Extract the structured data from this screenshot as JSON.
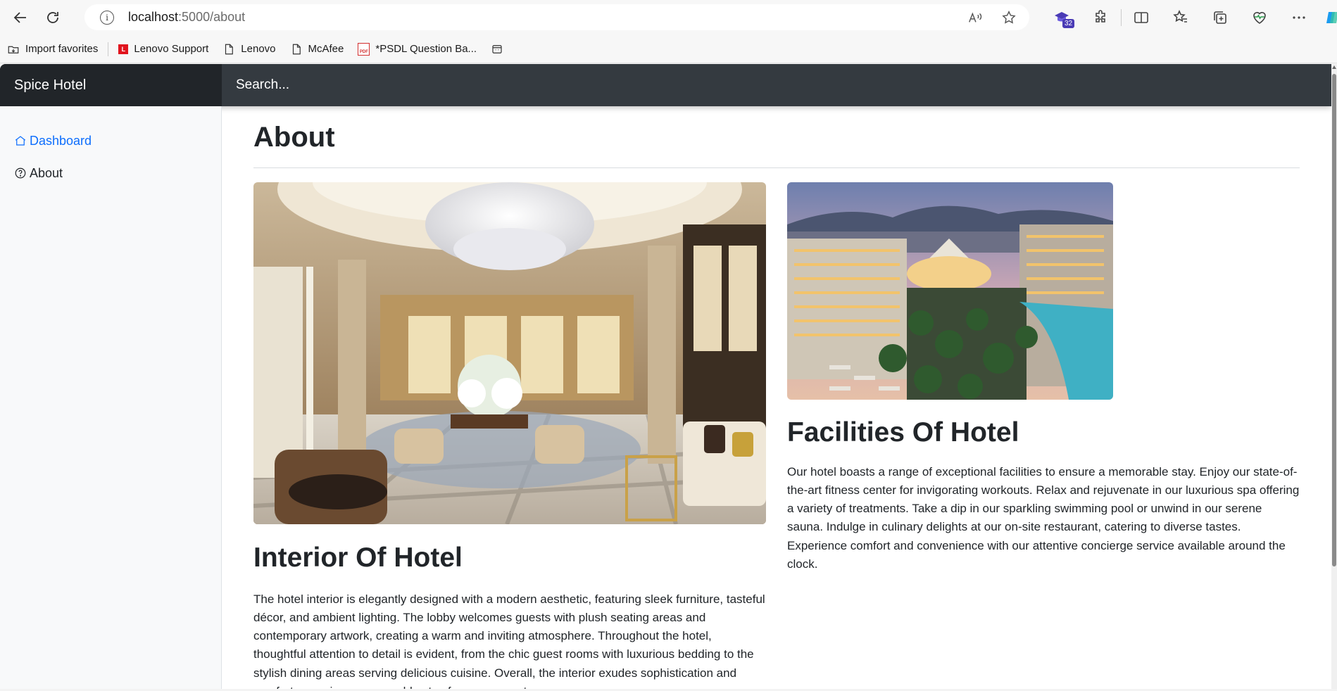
{
  "browser": {
    "url_host": "localhost",
    "url_path": ":5000/about",
    "extensions_badge": "32",
    "bookmarks": [
      {
        "label": "Import favorites",
        "icon": "import-icon"
      },
      {
        "label": "Lenovo Support",
        "icon": "lenovo-icon"
      },
      {
        "label": "Lenovo",
        "icon": "page-icon"
      },
      {
        "label": "McAfee",
        "icon": "page-icon"
      },
      {
        "label": "*PSDL Question Ba...",
        "icon": "pdf-icon"
      }
    ]
  },
  "app": {
    "brand": "Spice Hotel",
    "search_placeholder": "Search...",
    "sidebar": [
      {
        "label": "Dashboard",
        "icon": "home-icon",
        "active": true
      },
      {
        "label": "About",
        "icon": "question-circle-icon",
        "active": false
      }
    ],
    "page_title": "About",
    "cards": [
      {
        "heading": "Interior Of Hotel",
        "image": "hotel-lobby-photo",
        "text": "The hotel interior is elegantly designed with a modern aesthetic, featuring sleek furniture, tasteful décor, and ambient lighting. The lobby welcomes guests with plush seating areas and contemporary artwork, creating a warm and inviting atmosphere. Throughout the hotel, thoughtful attention to detail is evident, from the chic guest rooms with luxurious bedding to the stylish dining areas serving delicious cuisine. Overall, the interior exudes sophistication and comfort, ensuring a memorable stay for every guest."
      },
      {
        "heading": "Facilities Of Hotel",
        "image": "hotel-resort-photo",
        "text": "Our hotel boasts a range of exceptional facilities to ensure a memorable stay. Enjoy our state-of-the-art fitness center for invigorating workouts. Relax and rejuvenate in our luxurious spa offering a variety of treatments. Take a dip in our sparkling swimming pool or unwind in our serene sauna. Indulge in culinary delights at our on-site restaurant, catering to diverse tastes. Experience comfort and convenience with our attentive concierge service available around the clock."
      }
    ]
  },
  "colors": {
    "topbar": "#343a40",
    "brand_bg": "#212529",
    "link_active": "#0d6efd",
    "sidebar_bg": "#f8f9fa"
  }
}
